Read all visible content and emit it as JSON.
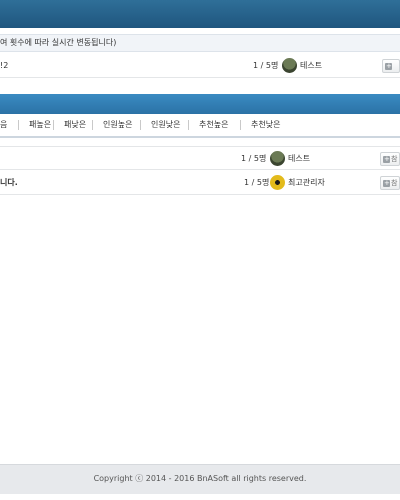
{
  "notice": {
    "text": "여 횟수에 따라 실시간 변동됩니다)"
  },
  "featured_room": {
    "title": "!2",
    "count": "1 / 5명",
    "owner": "테스트",
    "avatar_icon": "soldier-helmet-icon"
  },
  "sort_tabs": [
    "음",
    "패높은",
    "패낮은",
    "인원높은",
    "인원낮은",
    "추천높은",
    "추천낮은"
  ],
  "rooms": [
    {
      "title": "",
      "count": "1 / 5명",
      "owner": "테스트",
      "avatar_icon": "soldier-helmet-icon",
      "button_label": "참"
    },
    {
      "title": "니다.",
      "count": "1 / 5명",
      "owner": "최고관리자",
      "avatar_icon": "radiation-badge-icon",
      "button_label": "참"
    }
  ],
  "footer": {
    "copyright": "Copyright ⓒ 2014 - 2016 BnASoft all rights reserved."
  },
  "colors": {
    "header": "#1f567f",
    "bluebar": "#2b72a6",
    "footer_bg": "#e7e9ec"
  }
}
